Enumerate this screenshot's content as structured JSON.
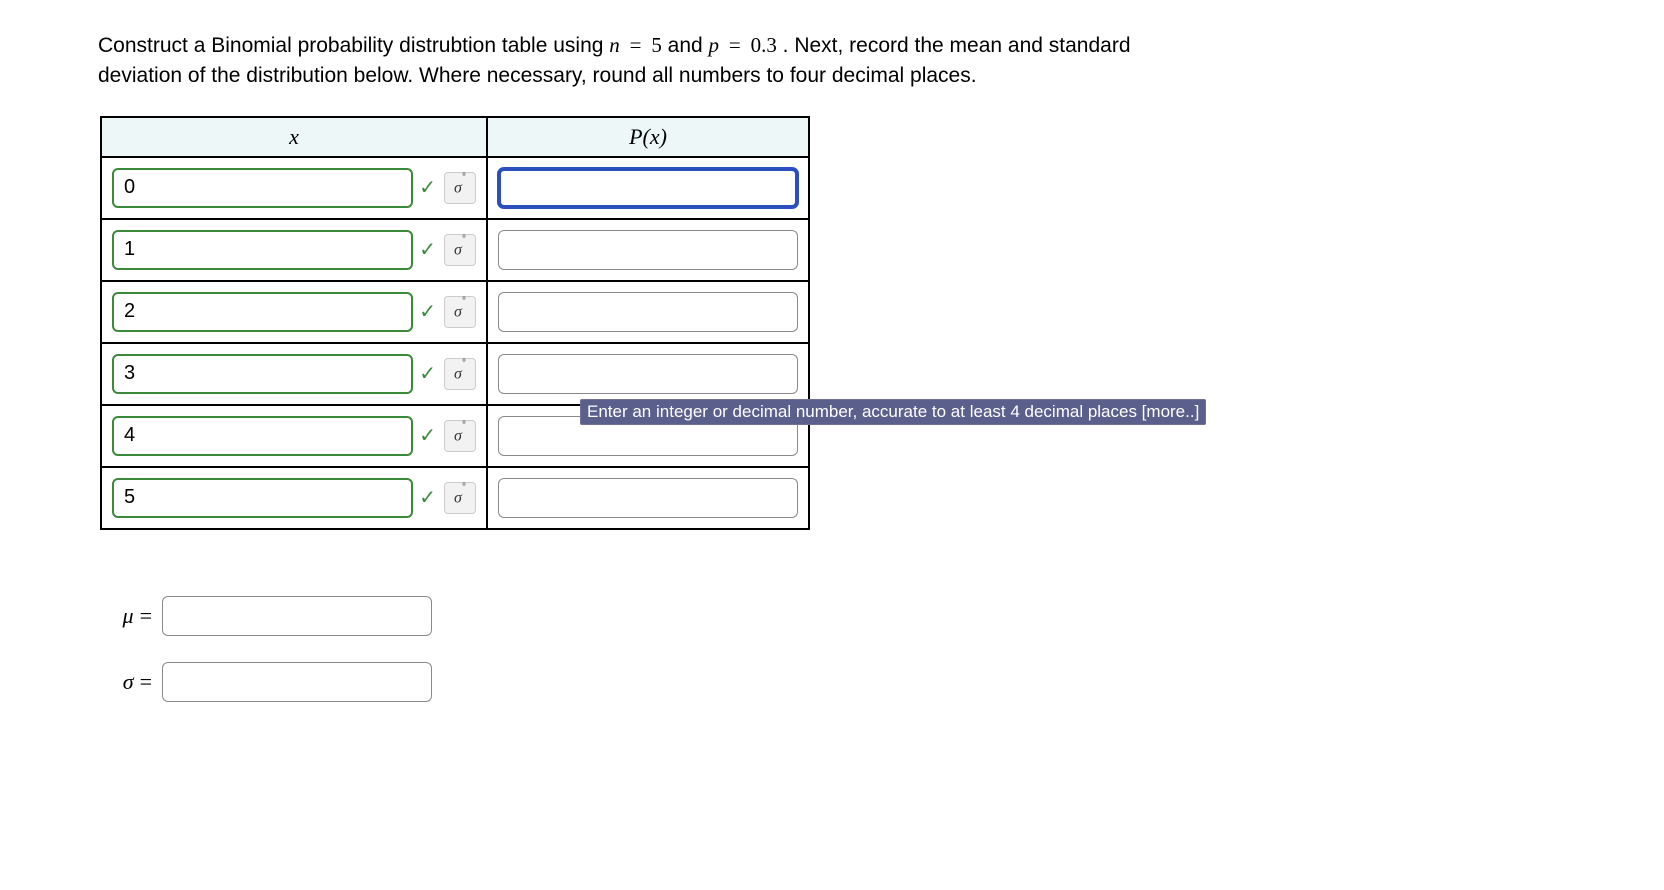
{
  "prompt": {
    "part1": "Construct a Binomial probability distrubtion table using ",
    "n_sym": "n",
    "eq1": "=",
    "n_val": "5",
    "part2": " and ",
    "p_sym": "p",
    "eq2": "=",
    "p_val": "0.3",
    "part3": ". Next, record the mean and standard deviation of the distribution below. Where necessary, round all numbers to four decimal places."
  },
  "headers": {
    "x": "x",
    "px_open": "P(",
    "px_var": "x",
    "px_close": ")"
  },
  "rows": [
    {
      "x": "0",
      "p": "",
      "focus": true
    },
    {
      "x": "1",
      "p": "",
      "focus": false
    },
    {
      "x": "2",
      "p": "",
      "focus": false
    },
    {
      "x": "3",
      "p": "",
      "focus": false
    },
    {
      "x": "4",
      "p": "",
      "focus": false
    },
    {
      "x": "5",
      "p": "",
      "focus": false
    }
  ],
  "tooltip": "Enter an integer or decimal number, accurate to at least 4 decimal places [more..]",
  "icons": {
    "check": "✓",
    "formula": "σ"
  },
  "stats": {
    "mu_sym": "μ",
    "mu_eq": "=",
    "mu_val": "",
    "sigma_sym": "σ",
    "sigma_eq": "=",
    "sigma_val": ""
  }
}
